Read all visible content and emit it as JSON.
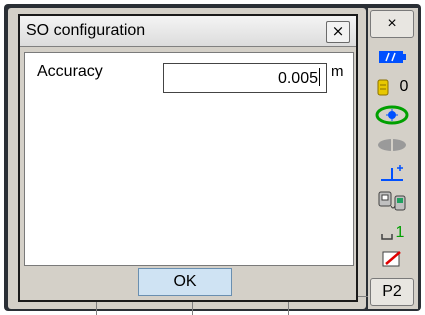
{
  "background": {
    "title_stub": "S"
  },
  "dialog": {
    "title": "SO configuration",
    "close_label": "×",
    "accuracy_label": "Accuracy",
    "accuracy_value": "0.005",
    "accuracy_unit": "m",
    "ok_label": "OK"
  },
  "sidebar": {
    "close_label": "×",
    "prism_constant": "0",
    "page_label": "P2",
    "subscript_label": "1"
  },
  "colors": {
    "battery": "#0050ff",
    "tilt": "#00a000",
    "target": "#0050ff",
    "laser_red": "#e00000"
  },
  "icons": {
    "battery": "battery-icon",
    "prism": "prism-icon",
    "tilt": "tilt-icon",
    "laser": "laser-pointer-icon",
    "target": "target-icon",
    "communication": "communication-icon",
    "input_mode": "input-mode-icon",
    "edit": "edit-icon"
  }
}
